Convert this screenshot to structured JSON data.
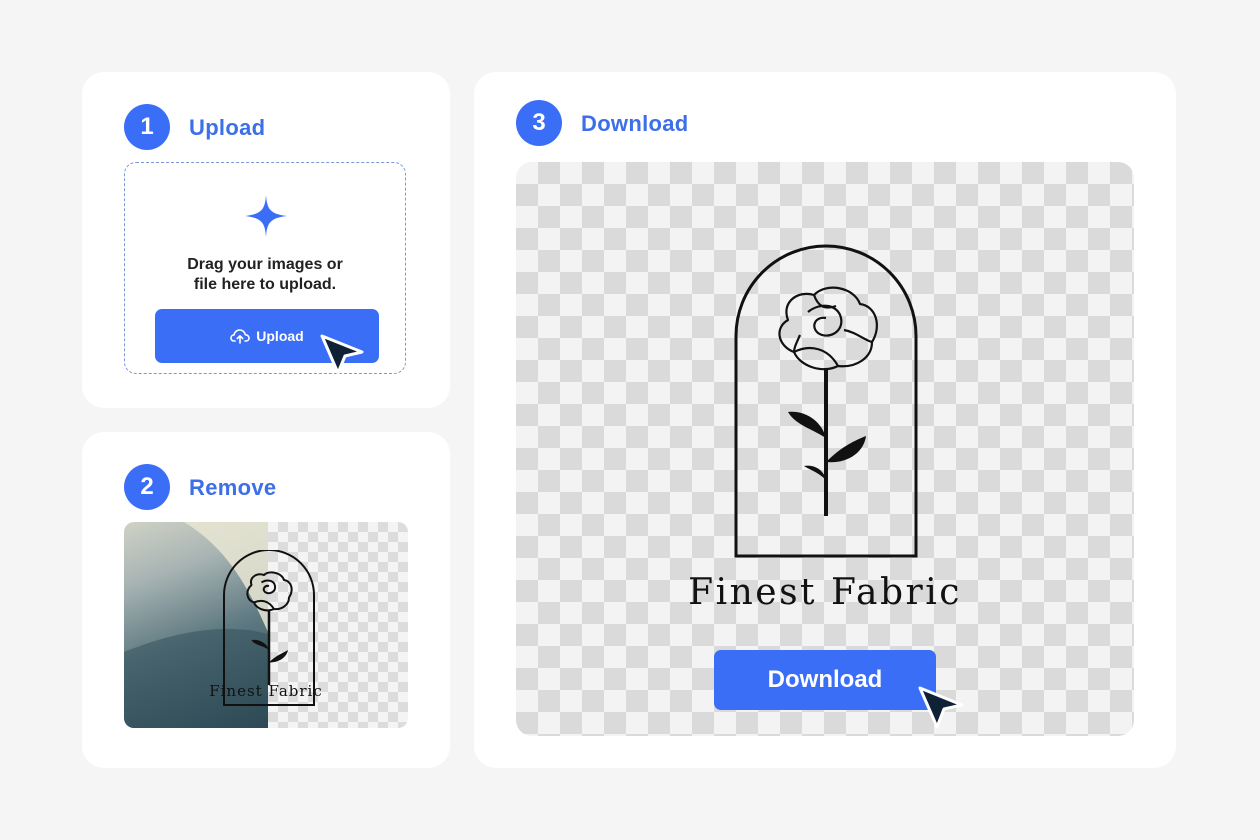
{
  "steps": {
    "upload": {
      "number": "1",
      "title": "Upload",
      "drop_text_line1": "Drag your images or",
      "drop_text_line2": "file here to upload.",
      "button_label": "Upload"
    },
    "remove": {
      "number": "2",
      "title": "Remove",
      "logo_text": "Finest Fabric"
    },
    "download": {
      "number": "3",
      "title": "Download",
      "logo_text": "Finest Fabric",
      "button_label": "Download"
    }
  },
  "colors": {
    "accent": "#3b6ef6",
    "title": "#3d6fe8",
    "background": "#f5f5f5",
    "card": "#ffffff",
    "cursor": "#0f2235"
  },
  "icons": [
    "plus-sparkle-icon",
    "cloud-upload-icon",
    "cursor-arrow-icon",
    "rose-arch-logo"
  ]
}
